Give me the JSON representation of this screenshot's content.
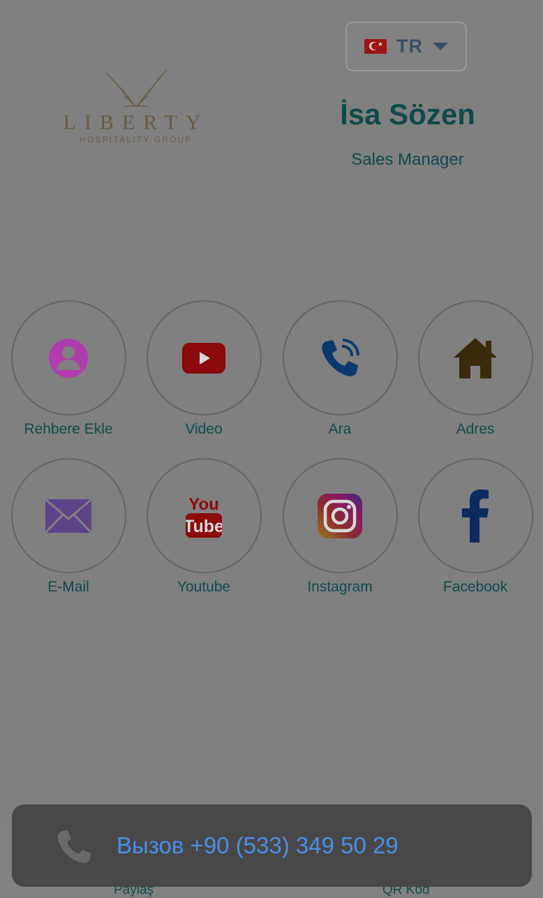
{
  "language": {
    "code": "TR",
    "flag": "turkey-flag-icon"
  },
  "logo": {
    "word": "LIBERTY",
    "subtitle": "HOSPITALITY GROUP"
  },
  "profile": {
    "name": "İsa Sözen",
    "title": "Sales Manager"
  },
  "actions": [
    {
      "label": "Rehbere Ekle",
      "icon": "contact-icon"
    },
    {
      "label": "Video",
      "icon": "video-play-icon"
    },
    {
      "label": "Ara",
      "icon": "phone-call-icon"
    },
    {
      "label": "Adres",
      "icon": "home-icon"
    },
    {
      "label": "E-Mail",
      "icon": "mail-icon"
    },
    {
      "label": "Youtube",
      "icon": "youtube-icon"
    },
    {
      "label": "Instagram",
      "icon": "instagram-icon"
    },
    {
      "label": "Facebook",
      "icon": "facebook-icon"
    }
  ],
  "bottom_nav": {
    "share_label": "Paylaş",
    "qr_label": "QR Kod"
  },
  "call_toast": {
    "text": "Вызов +90 (533) 349 50 29"
  },
  "colors": {
    "background": "#808080",
    "text_teal": "#0f4b4a",
    "toast_bg": "#484848",
    "toast_text": "#4a8fe8"
  }
}
